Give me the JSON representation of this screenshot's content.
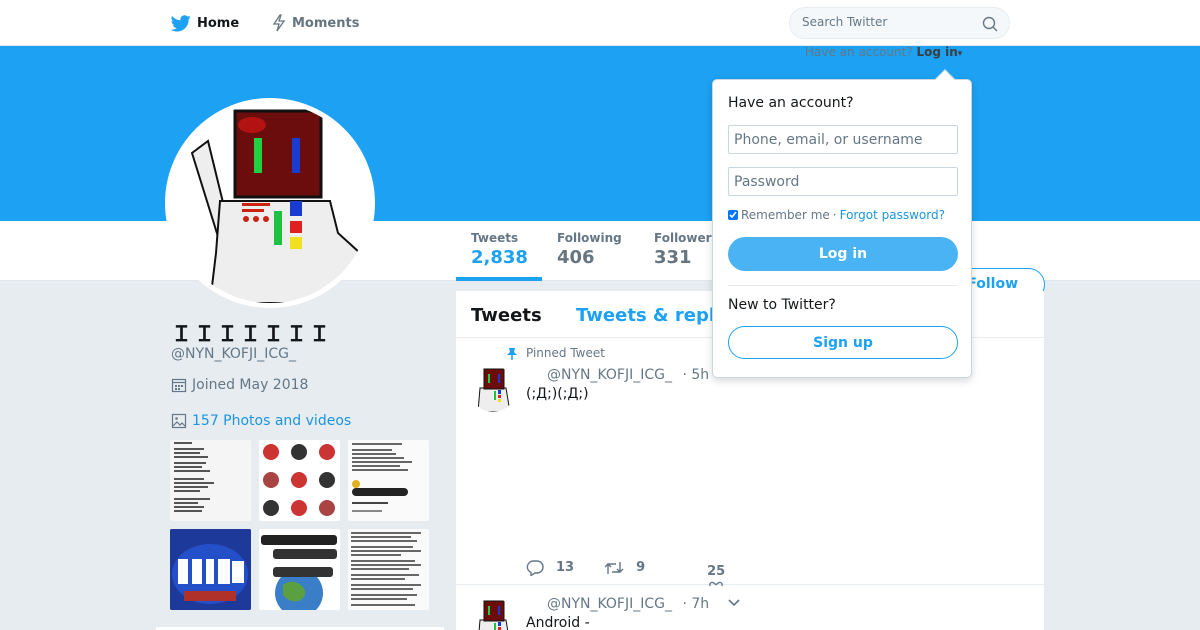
{
  "nav": {
    "home_label": "Home",
    "moments_label": "Moments",
    "search_placeholder": "Search Twitter"
  },
  "banner": {
    "have_account_text": "Have an account?",
    "login_label": "Log in",
    "login_caret": "▾",
    "color": "#1da1f2"
  },
  "profile": {
    "name": "ＩＩＩＩＩＩＩ",
    "handle": "@NYN_KOFJI_ICG_",
    "joined": "Joined May 2018",
    "photos_link": "157 Photos and videos"
  },
  "stats": [
    {
      "label": "Tweets",
      "value": "2,838"
    },
    {
      "label": "Following",
      "value": "406"
    },
    {
      "label": "Followers",
      "value": "331"
    }
  ],
  "follow_label": "Follow",
  "timeline": {
    "tabs": [
      "Tweets",
      "Tweets & replies"
    ],
    "tweets": [
      {
        "pinned_label": "Pinned Tweet",
        "handle": "@NYN_KOFJI_ICG_",
        "time": "· 5h",
        "text": "(;Д;)(;Д;)",
        "replies": "13",
        "retweets": "9",
        "likes": "25"
      },
      {
        "handle": "@NYN_KOFJI_ICG_",
        "time": "· 7h",
        "text": "Android -"
      }
    ]
  },
  "login_dropdown": {
    "title": "Have an account?",
    "username_placeholder": "Phone, email, or username",
    "password_placeholder": "Password",
    "remember_label": "Remember me",
    "separator": "·",
    "forgot_label": "Forgot password?",
    "login_button": "Log in",
    "new_text": "New to Twitter?",
    "signup_button": "Sign up"
  },
  "colors": {
    "accent": "#1da1f2",
    "link": "#1b95e0",
    "muted": "#657786",
    "background": "#e6ecf0"
  }
}
